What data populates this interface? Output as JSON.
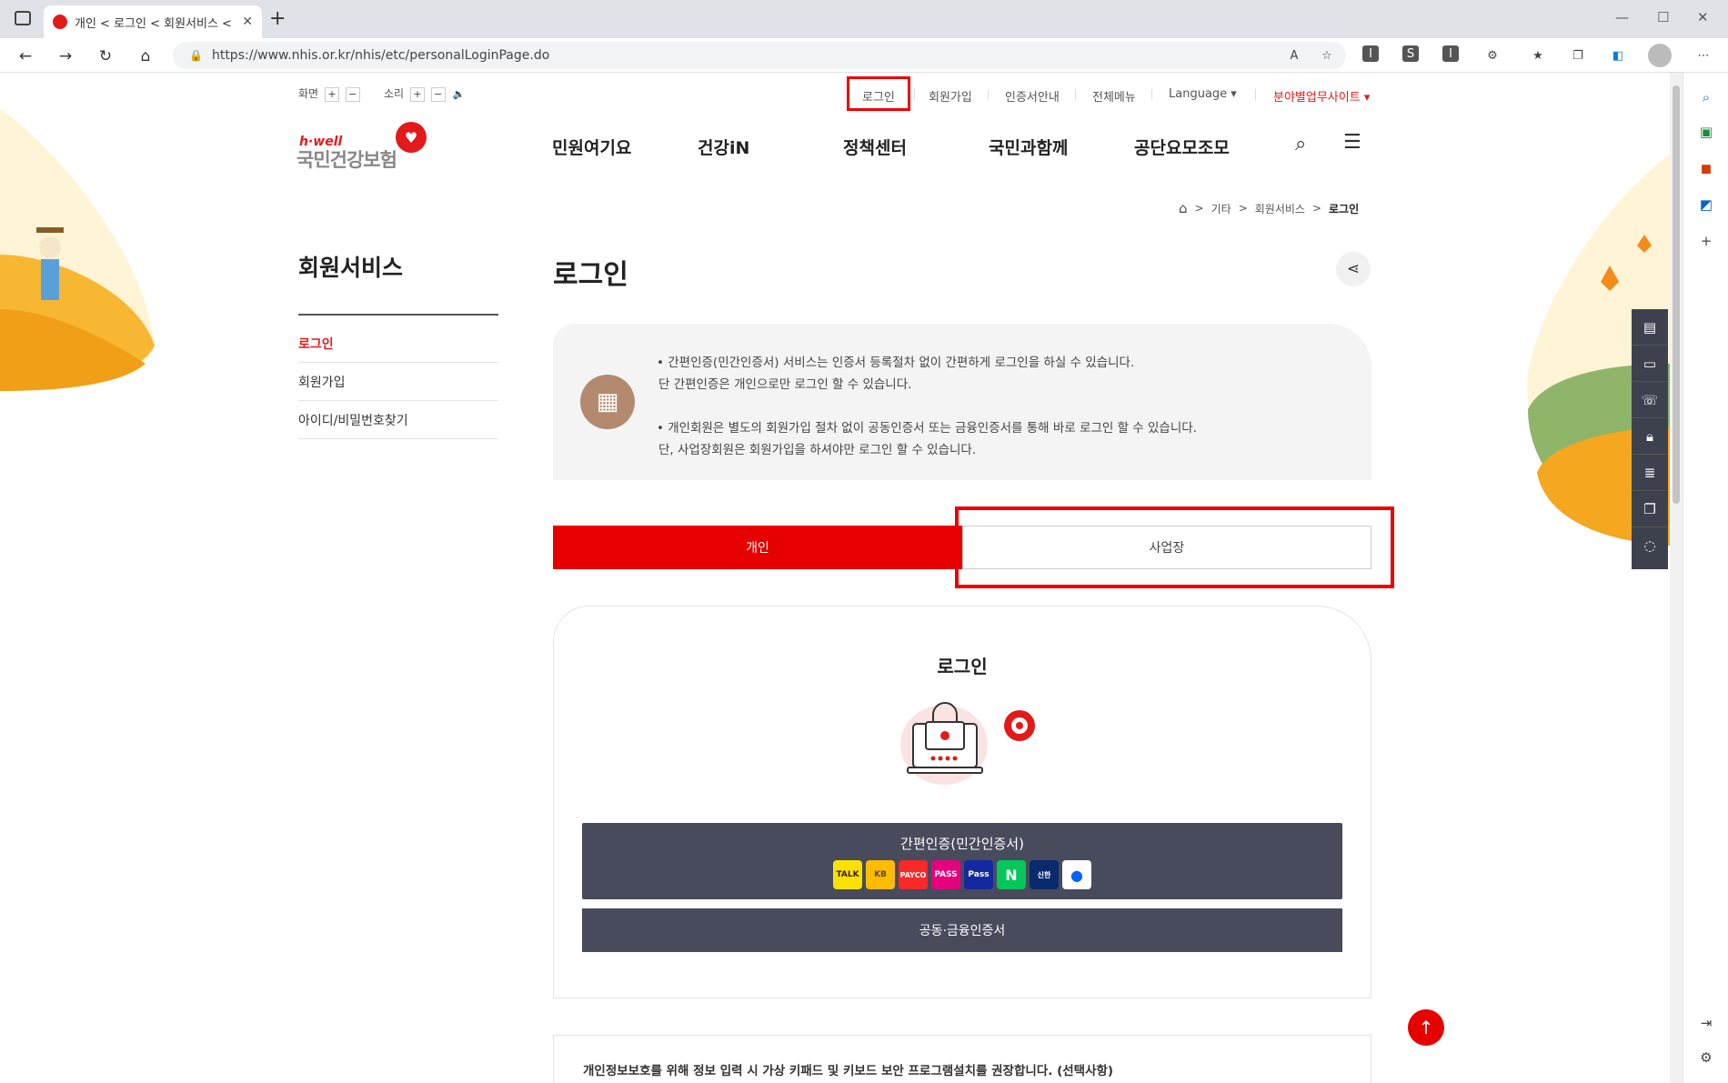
{
  "browser": {
    "tab_title": "개인 < 로그인 < 회원서비스 < 기타",
    "tab_close": "✕",
    "new_tab": "+",
    "url": "https://www.nhis.or.kr/nhis/etc/personalLoginPage.do"
  },
  "utility": {
    "screen_label": "화면",
    "sound_label": "소리",
    "plus": "+",
    "minus": "−",
    "speaker": "🔈"
  },
  "topmenu": {
    "login": "로그인",
    "join": "회원가입",
    "cert_info": "인증서안내",
    "all_menu": "전체메뉴",
    "language": "Language ▾",
    "field_sites": "분야별업무사이트 ▾"
  },
  "logo": {
    "small": "h·well",
    "main": "국민건강보험"
  },
  "gnb": [
    "민원여기요",
    "건강iN",
    "정책센터",
    "국민과함께",
    "공단요모조모"
  ],
  "breadcrumb": {
    "home_icon": "⌂",
    "items": [
      "기타",
      "회원서비스",
      "로그인"
    ],
    "separator": ">"
  },
  "sidebar": {
    "title": "회원서비스",
    "items": [
      {
        "label": "로그인",
        "active": true
      },
      {
        "label": "회원가입",
        "active": false
      },
      {
        "label": "아이디/비밀번호찾기",
        "active": false
      }
    ]
  },
  "main": {
    "title": "로그인",
    "notice": [
      "•  간편인증(민간인증서) 서비스는 인증서 등록절차 없이 간편하게 로그인을 하실 수 있습니다.",
      "단 간편인증은 개인으로만 로그인 할 수 있습니다.",
      "•  개인회원은 별도의 회원가입 절차 없이 공동인증서 또는 금융인증서를 통해 바로 로그인 할 수 있습니다.",
      "단, 사업장회원은 회원가입을 하셔야만 로그인 할 수 있습니다."
    ],
    "tabs": {
      "personal": "개인",
      "business": "사업장"
    },
    "card_title": "로그인",
    "simple_auth_label": "간편인증(민간인증서)",
    "auth_providers": [
      {
        "name": "TALK",
        "bg": "#fae100",
        "fg": "#3a1d1d"
      },
      {
        "name": "KB",
        "bg": "#ffbc00",
        "fg": "#5a4a3a"
      },
      {
        "name": "PAYCO",
        "bg": "#fa2828",
        "fg": "#ffffff"
      },
      {
        "name": "PASS",
        "bg": "#e5007e",
        "fg": "#ffffff"
      },
      {
        "name": "Pass",
        "bg": "#1428a0",
        "fg": "#ffffff"
      },
      {
        "name": "N",
        "bg": "#03c75a",
        "fg": "#ffffff"
      },
      {
        "name": "신한",
        "bg": "#0046ff",
        "fg": "#ffffff"
      },
      {
        "name": "●",
        "bg": "#ffffff",
        "fg": "#0064ff"
      }
    ],
    "cert_button": "공동·금융인증서",
    "security_notice": "개인정보보호를 위해 정보 입력 시 가상 키패드 및 키보드 보안 프로그램설치를 권장합니다. (선택사항)"
  },
  "colors": {
    "brand_red": "#e60000",
    "button_dark": "#474b5c",
    "highlight": "#ee0000"
  }
}
